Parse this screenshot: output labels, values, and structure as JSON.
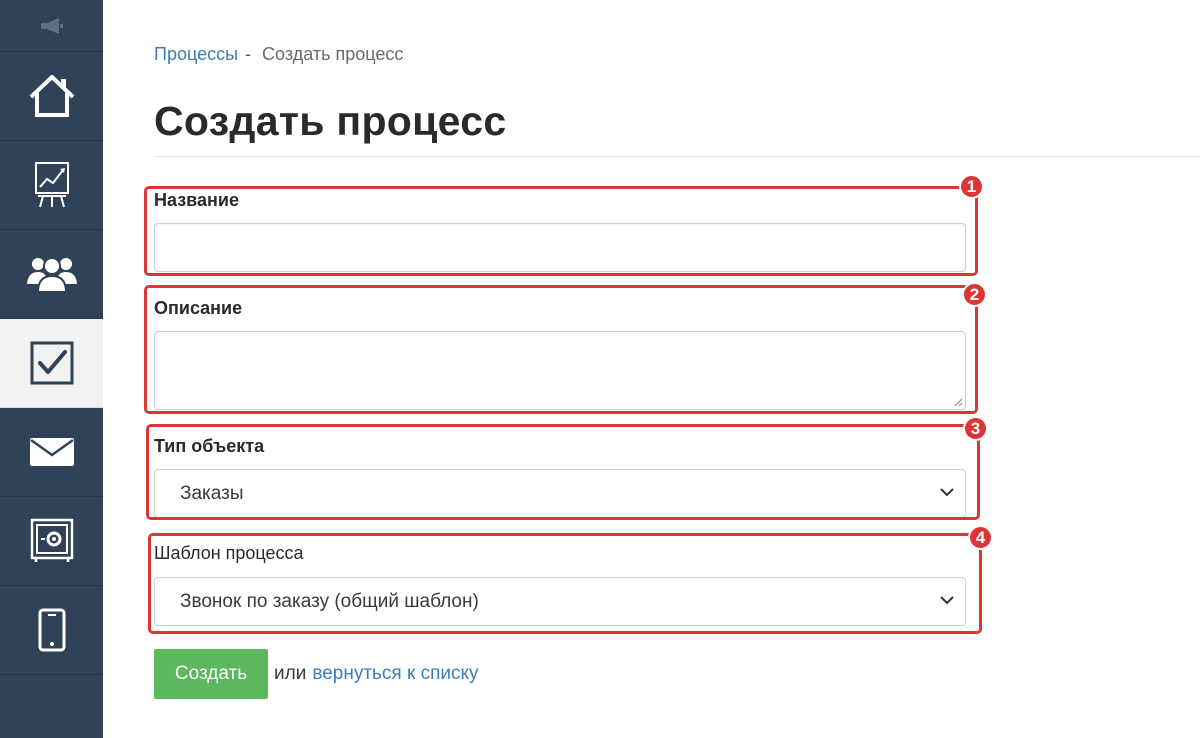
{
  "sidebar": {
    "items": [
      {
        "icon": "home-icon"
      },
      {
        "icon": "chart-board-icon"
      },
      {
        "icon": "users-icon"
      },
      {
        "icon": "checkbox-icon",
        "active": true
      },
      {
        "icon": "mail-icon"
      },
      {
        "icon": "safe-icon"
      },
      {
        "icon": "phone-icon"
      }
    ]
  },
  "breadcrumb": {
    "link": "Процессы",
    "separator": "-",
    "current": "Создать процесс"
  },
  "page_title": "Создать процесс",
  "form": {
    "name": {
      "label": "Название",
      "value": ""
    },
    "description": {
      "label": "Описание",
      "value": ""
    },
    "object_type": {
      "label": "Тип объекта",
      "selected": "Заказы"
    },
    "template": {
      "label": "Шаблон процесса",
      "selected": "Звонок по заказу (общий шаблон)"
    }
  },
  "annotations": [
    "1",
    "2",
    "3",
    "4"
  ],
  "actions": {
    "create_label": "Создать",
    "or_text": "или",
    "back_link": "вернуться к списку"
  },
  "colors": {
    "sidebar": "#2f4257",
    "accent_link": "#3d7db5",
    "create_button": "#5cb85c",
    "annotation": "#dc3535"
  }
}
